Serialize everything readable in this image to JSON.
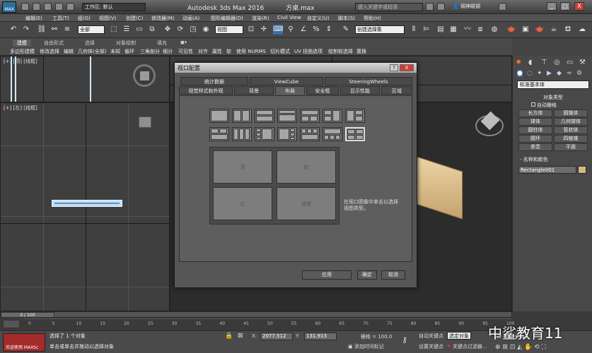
{
  "window": {
    "app_title": "Autodesk 3ds Max 2016",
    "file_name": "方桌.max",
    "workspace": "工作区: 默认",
    "search_placeholder": "键入关键字或短语",
    "user": "钢神碰钢",
    "controls": [
      "_",
      "□",
      "X"
    ]
  },
  "menu": [
    "编辑(E)",
    "工具(T)",
    "组(G)",
    "视图(V)",
    "创建(C)",
    "修改器(M)",
    "动画(A)",
    "图形编辑器(D)",
    "渲染(R)",
    "Civil View",
    "自定义(U)",
    "脚本(S)",
    "帮助(H)"
  ],
  "toolbar": {
    "filter_value": "全部",
    "refcoord_value": "视图",
    "selset_value": "创建选择集"
  },
  "ribbon": {
    "tabs": [
      "建模",
      "自由形式",
      "选择",
      "对象绘制",
      "填充"
    ],
    "active_tab": 0,
    "items": [
      "多边形建模",
      "修改选择",
      "编辑",
      "几何体(全部)",
      "未知",
      "循环",
      "三角剖分",
      "细分",
      "可见性",
      "对齐",
      "属性",
      "软",
      "使用 NURMS",
      "切片模式",
      "UV 扭曲选项",
      "绘制软选择",
      "置换"
    ]
  },
  "viewports": {
    "top": "[+] [顶] [线框]",
    "left": "[+] [左] [线框]"
  },
  "command_panel": {
    "dropdown": "标准基本体",
    "object_type_title": "对象类型",
    "autogrid": "自动栅格",
    "buttons": [
      "长方体",
      "圆锥体",
      "球体",
      "几何球体",
      "圆柱体",
      "管状体",
      "圆环",
      "四棱锥",
      "茶壶",
      "平面"
    ],
    "name_color_title": "名称和颜色",
    "object_name": "Rectangle001",
    "object_color": "#d7b884"
  },
  "dialog": {
    "title": "视口配置",
    "help": "?",
    "close": "X",
    "tabs_row1": [
      "统计数据",
      "ViewCube",
      "SteeringWheels"
    ],
    "tabs_row2": [
      "视觉样式和外观",
      "背景",
      "布局",
      "安全框",
      "显示性能",
      "区域"
    ],
    "active_tab": "布局",
    "preview_labels": [
      "顶",
      "前",
      "左",
      "透视"
    ],
    "hint": "在视口图像中单击以选择视图类型。",
    "buttons": {
      "apply": "应用",
      "ok": "确定",
      "cancel": "取消"
    }
  },
  "timeline": {
    "counter": "0 / 100",
    "ticks": [
      "0",
      "5",
      "10",
      "15",
      "20",
      "25",
      "30",
      "35",
      "40",
      "45",
      "50",
      "55",
      "60",
      "65",
      "70",
      "75",
      "80",
      "85",
      "90",
      "95",
      "100"
    ]
  },
  "status": {
    "welcome": "欢迎使用 MAXSc",
    "message1": "选择了 1 个对象",
    "message2": "单击或单击并拖动以选择对象",
    "x_label": "X:",
    "x_value": "2077.512",
    "y_label": "Y:",
    "y_value": "131.913",
    "grid": "栅格 = 100.0",
    "auto_key": "自动关键点",
    "selected": "选定对象",
    "set_key": "设置关键点",
    "key_filters": "关键点过滤器...",
    "add_time_tag": "添加时间标记"
  },
  "watermark": "中鲨教育11"
}
